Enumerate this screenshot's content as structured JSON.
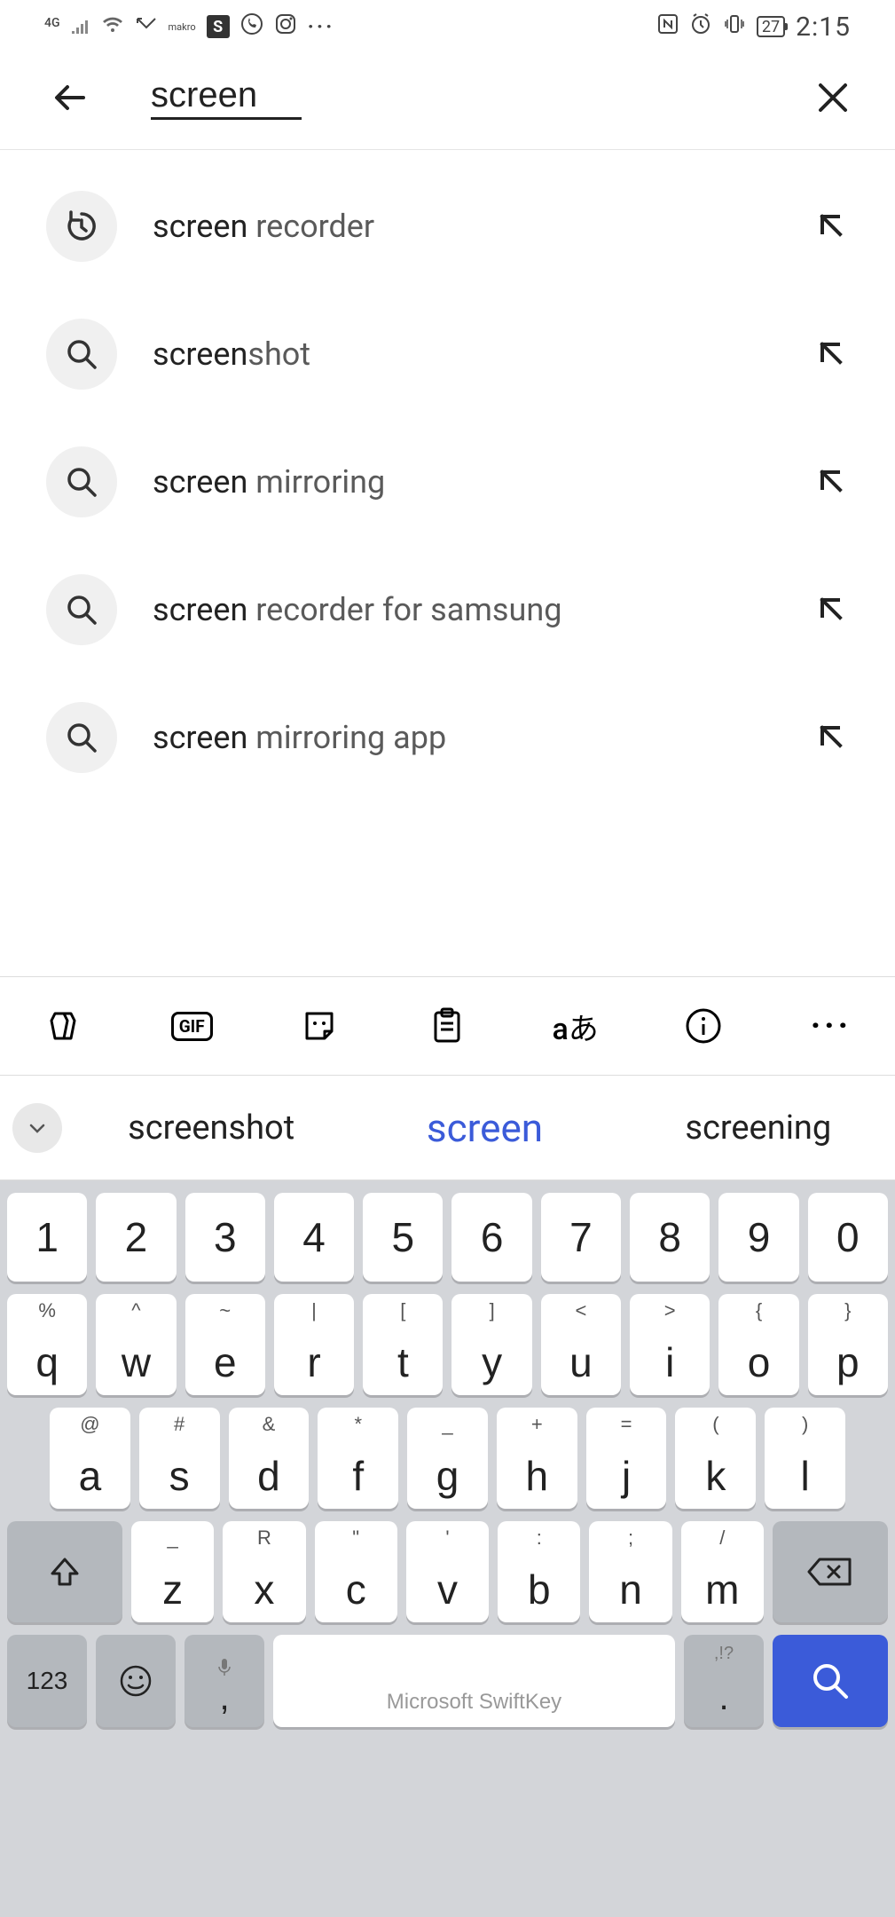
{
  "status": {
    "sig": "4G",
    "makro": "makro",
    "s": "S",
    "battery": "27",
    "time": "2:15"
  },
  "search": {
    "query": "screen"
  },
  "suggestions": [
    {
      "match": "screen",
      "rest": " recorder",
      "type": "history"
    },
    {
      "match": "screen",
      "rest": "shot",
      "type": "search"
    },
    {
      "match": "screen",
      "rest": " mirroring",
      "type": "search"
    },
    {
      "match": "screen",
      "rest": " recorder for samsung",
      "type": "search"
    },
    {
      "match": "screen",
      "rest": " mirroring app",
      "type": "search"
    }
  ],
  "keyboard": {
    "toolbar": {
      "gif": "GIF"
    },
    "predictions": {
      "left": "screenshot",
      "center": "screen",
      "right": "screening"
    },
    "row0": [
      "1",
      "2",
      "3",
      "4",
      "5",
      "6",
      "7",
      "8",
      "9",
      "0"
    ],
    "row1": [
      {
        "main": "q",
        "sup": "%"
      },
      {
        "main": "w",
        "sup": "^"
      },
      {
        "main": "e",
        "sup": "~"
      },
      {
        "main": "r",
        "sup": "|"
      },
      {
        "main": "t",
        "sup": "["
      },
      {
        "main": "y",
        "sup": "]"
      },
      {
        "main": "u",
        "sup": "<"
      },
      {
        "main": "i",
        "sup": ">"
      },
      {
        "main": "o",
        "sup": "{"
      },
      {
        "main": "p",
        "sup": "}"
      }
    ],
    "row2": [
      {
        "main": "a",
        "sup": "@"
      },
      {
        "main": "s",
        "sup": "#"
      },
      {
        "main": "d",
        "sup": "&"
      },
      {
        "main": "f",
        "sup": "*"
      },
      {
        "main": "g",
        "sup": "_"
      },
      {
        "main": "h",
        "sup": "+"
      },
      {
        "main": "j",
        "sup": "="
      },
      {
        "main": "k",
        "sup": "("
      },
      {
        "main": "l",
        "sup": ")"
      }
    ],
    "row3": [
      {
        "main": "z",
        "sup": "_"
      },
      {
        "main": "x",
        "sup": "R"
      },
      {
        "main": "c",
        "sup": "\""
      },
      {
        "main": "v",
        "sup": "'"
      },
      {
        "main": "b",
        "sup": ":"
      },
      {
        "main": "n",
        "sup": ";"
      },
      {
        "main": "m",
        "sup": "/"
      }
    ],
    "sym_label": "123",
    "comma": ",",
    "period": ".",
    "period_sup": ",!?",
    "space_brand": "Microsoft SwiftKey"
  }
}
